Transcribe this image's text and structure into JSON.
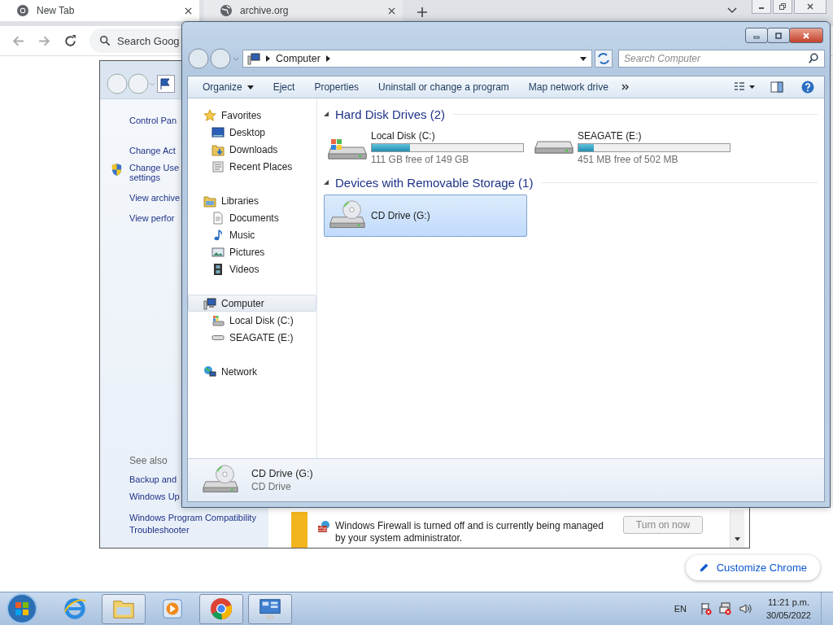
{
  "browser": {
    "tabs": [
      {
        "title": "New Tab",
        "selected": true
      },
      {
        "title": "archive.org",
        "selected": false
      }
    ],
    "omnibox": {
      "placeholder": "Search Goog"
    },
    "customize_button": "Customize Chrome"
  },
  "control_panel": {
    "links": [
      {
        "label": "Control Pan",
        "shield": false
      },
      {
        "label": "Change Act",
        "shield": false
      },
      {
        "label": "Change Use settings",
        "shield": true
      },
      {
        "label": "View archive",
        "shield": false
      },
      {
        "label": "View perfor",
        "shield": false
      }
    ],
    "see_also_heading": "See also",
    "see_also": [
      "Backup and",
      "Windows Up",
      "Windows Program Compatibility Troubleshooter"
    ],
    "firewall": {
      "message": "Windows Firewall is turned off and is currently being managed by your system administrator.",
      "button": "Turn on now"
    }
  },
  "explorer": {
    "address": "Computer",
    "search": {
      "placeholder": "Search Computer"
    },
    "toolbar": [
      {
        "label": "Organize",
        "dropdown": true
      },
      {
        "label": "Eject",
        "dropdown": false
      },
      {
        "label": "Properties",
        "dropdown": false
      },
      {
        "label": "Uninstall or change a program",
        "dropdown": false
      },
      {
        "label": "Map network drive",
        "dropdown": false
      }
    ],
    "nav": [
      {
        "label": "Favorites",
        "kind": "star",
        "selected": false,
        "children": [
          {
            "label": "Desktop",
            "kind": "desktop",
            "selected": false
          },
          {
            "label": "Downloads",
            "kind": "downloads",
            "selected": false
          },
          {
            "label": "Recent Places",
            "kind": "recent",
            "selected": false
          }
        ]
      },
      {
        "label": "Libraries",
        "kind": "libraries",
        "selected": false,
        "children": [
          {
            "label": "Documents",
            "kind": "documents",
            "selected": false
          },
          {
            "label": "Music",
            "kind": "music",
            "selected": false
          },
          {
            "label": "Pictures",
            "kind": "pictures",
            "selected": false
          },
          {
            "label": "Videos",
            "kind": "videos",
            "selected": false
          }
        ]
      },
      {
        "label": "Computer",
        "kind": "computer",
        "selected": true,
        "children": [
          {
            "label": "Local Disk (C:)",
            "kind": "hdd-windows",
            "selected": false
          },
          {
            "label": "SEAGATE (E:)",
            "kind": "hdd",
            "selected": false
          }
        ]
      },
      {
        "label": "Network",
        "kind": "network",
        "selected": false
      }
    ],
    "groups": [
      {
        "title": "Hard Disk Drives (2)",
        "items": [
          {
            "name": "Local Disk (C:)",
            "kind": "hdd-windows",
            "free": "111 GB free of 149 GB",
            "level": 0.25,
            "selected": false
          },
          {
            "name": "SEAGATE (E:)",
            "kind": "hdd",
            "free": "451 MB free of 502 MB",
            "level": 0.1,
            "selected": false
          }
        ]
      },
      {
        "title": "Devices with Removable Storage (1)",
        "items": [
          {
            "name": "CD Drive (G:)",
            "kind": "cd",
            "selected": true
          }
        ]
      }
    ],
    "details": {
      "name": "CD Drive (G:)",
      "type": "CD Drive"
    }
  },
  "taskbar": {
    "apps": [
      {
        "kind": "ie",
        "running": false
      },
      {
        "kind": "explorer",
        "running": true
      },
      {
        "kind": "media",
        "running": false
      },
      {
        "kind": "chrome",
        "running": true
      },
      {
        "kind": "control-panel",
        "running": true
      }
    ],
    "language": "EN",
    "time": "11:21 p.m.",
    "date": "30/05/2022"
  }
}
